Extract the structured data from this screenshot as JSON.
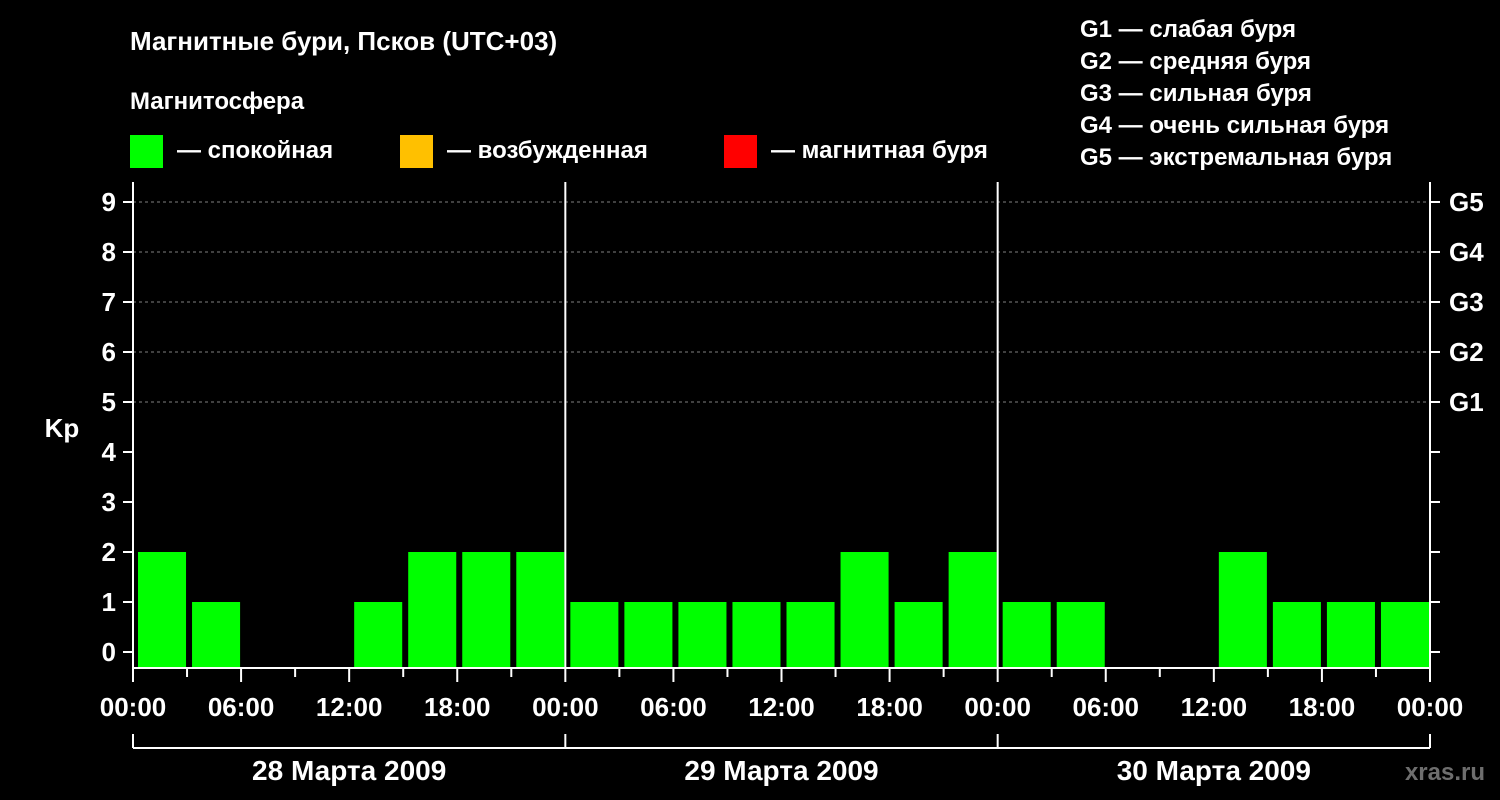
{
  "title": "Магнитные бури, Псков (UTC+03)",
  "magnetosphere_label": "Магнитосфера",
  "legend": [
    {
      "label": "— спокойная",
      "color": "#00ff00"
    },
    {
      "label": "— возбужденная",
      "color": "#ffc000"
    },
    {
      "label": "— магнитная буря",
      "color": "#ff0000"
    }
  ],
  "g_legend": [
    "G1 — слабая буря",
    "G2 — средняя буря",
    "G3 — сильная буря",
    "G4 — очень сильная буря",
    "G5 — экстремальная буря"
  ],
  "watermark": "xras.ru",
  "colors": {
    "background": "#000000",
    "quiet": "#00ff00",
    "grid": "#808080",
    "axis": "#ffffff"
  },
  "chart_data": {
    "type": "bar",
    "ylabel": "Kp",
    "ylim": [
      0,
      9
    ],
    "yticks": [
      0,
      1,
      2,
      3,
      4,
      5,
      6,
      7,
      8,
      9
    ],
    "right_labels": [
      {
        "kp": 5,
        "label": "G1"
      },
      {
        "kp": 6,
        "label": "G2"
      },
      {
        "kp": 7,
        "label": "G3"
      },
      {
        "kp": 8,
        "label": "G4"
      },
      {
        "kp": 9,
        "label": "G5"
      }
    ],
    "dashed_grid_at": [
      5,
      6,
      7,
      8,
      9
    ],
    "interval_hours": 3,
    "xtick_labels": [
      "00:00",
      "06:00",
      "12:00",
      "18:00",
      "00:00",
      "06:00",
      "12:00",
      "18:00",
      "00:00",
      "06:00",
      "12:00",
      "18:00",
      "00:00"
    ],
    "days": [
      "28 Марта 2009",
      "29 Марта 2009",
      "30 Марта 2009"
    ],
    "series": [
      {
        "values": [
          2,
          1,
          0,
          0,
          1,
          2,
          2,
          2,
          1,
          1,
          1,
          1,
          1,
          2,
          1,
          2,
          1,
          1,
          0,
          0,
          2,
          1,
          1,
          1
        ]
      }
    ]
  }
}
